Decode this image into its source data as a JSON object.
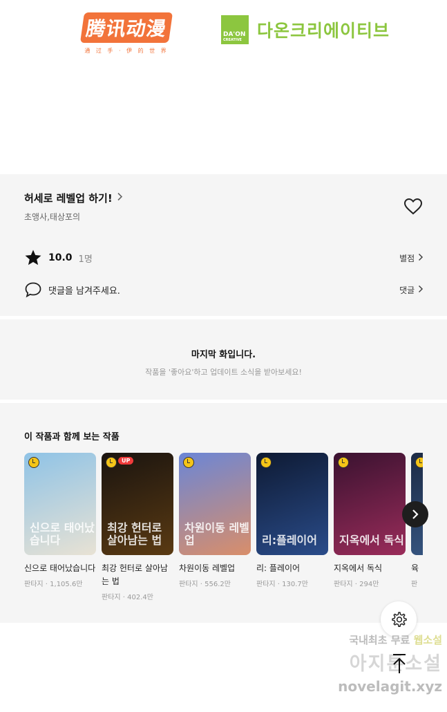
{
  "logos": {
    "left_main": "腾讯动漫",
    "left_sub": "通 过 手 · 伊 的 世 界",
    "right_mark_line1": "DA'ON",
    "right_mark_line2": "CREATIVE",
    "right_name": "다온크리에이티브"
  },
  "work": {
    "title": "허세로 레벨업 하기!",
    "authors": "초앵사,태상포의",
    "rating_score": "10.0",
    "rating_count": "1명",
    "rating_link": "별점",
    "comment_prompt": "댓글을 남겨주세요.",
    "comment_link": "댓글"
  },
  "last_episode": {
    "heading": "마지막 화입니다.",
    "subtext": "작품을 '좋아요'하고 업데이트 소식을 받아보세요!"
  },
  "recommendations": {
    "heading": "이 작품과 함께 보는 작품",
    "items": [
      {
        "cover_title": "신으로 태어났습니다",
        "name": "신으로 태어났습니다",
        "genre": "판타지",
        "views": "1,105.6만",
        "badge": "",
        "colors": [
          "#8fc3e6",
          "#e8e2d4"
        ]
      },
      {
        "cover_title": "최강 헌터로 살아남는 법",
        "name": "최강 헌터로 살아남는 법",
        "genre": "판타지",
        "views": "402.4만",
        "badge": "UP",
        "colors": [
          "#1a1410",
          "#5a3a12"
        ]
      },
      {
        "cover_title": "차원이동 레벨업",
        "name": "차원이동 레벨업",
        "genre": "판타지",
        "views": "556.2만",
        "badge": "",
        "colors": [
          "#6b86d6",
          "#d98e6a"
        ]
      },
      {
        "cover_title": "리:플레이어",
        "name": "리: 플레이어",
        "genre": "판타지",
        "views": "130.7만",
        "badge": "",
        "colors": [
          "#0e1a33",
          "#2a4c8a"
        ]
      },
      {
        "cover_title": "지옥에서 독식",
        "name": "지옥에서 독식",
        "genre": "판타지",
        "views": "294만",
        "badge": "",
        "colors": [
          "#3a1230",
          "#9a2c5a"
        ]
      },
      {
        "cover_title": "",
        "name": "육",
        "genre": "판",
        "views": "",
        "badge": "",
        "colors": [
          "#1c2a44",
          "#3a5c8a"
        ]
      }
    ]
  },
  "watermark": {
    "line1_prefix": "국내최초 무료",
    "line1_highlight": "웹소설",
    "line2": "아지툰소설",
    "line3": "novelagit.xyz"
  },
  "icons": {
    "heart": "heart-outline-icon",
    "star": "star-icon",
    "comment": "speech-bubble-icon",
    "chevron": "chevron-right-icon",
    "clock": "clock-icon",
    "next": "chevron-right-icon",
    "settings": "gear-icon",
    "top": "arrow-up-icon"
  }
}
